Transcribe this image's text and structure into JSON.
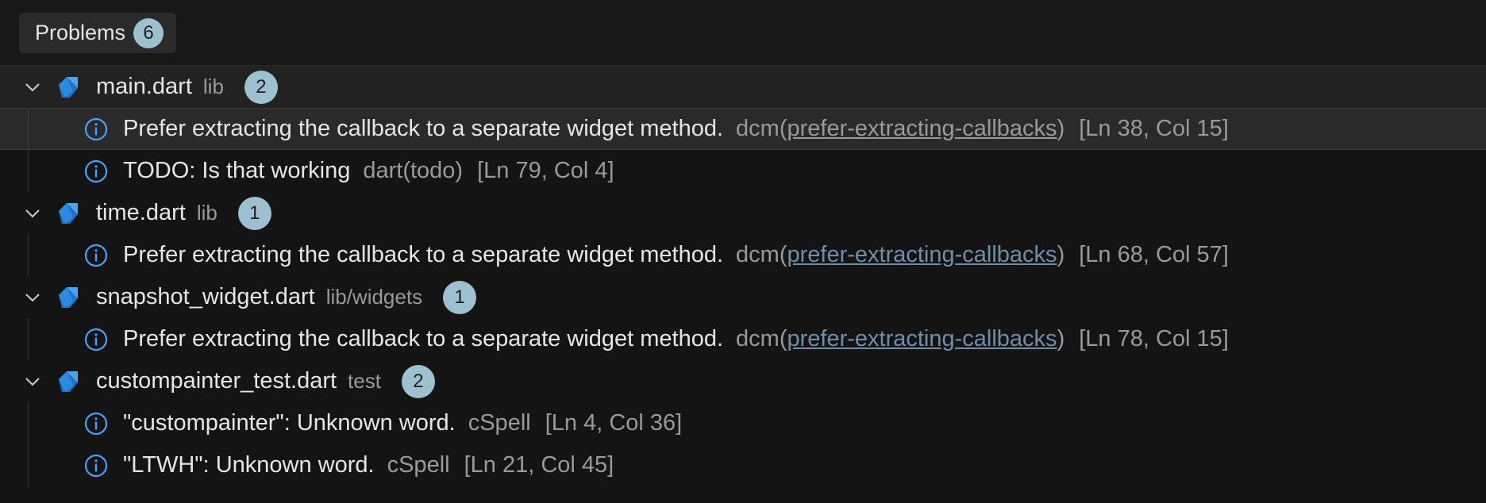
{
  "panel": {
    "tab_label": "Problems",
    "total_count": "6"
  },
  "files": [
    {
      "name": "main.dart",
      "dir": "lib",
      "count": "2",
      "problems": [
        {
          "message": "Prefer extracting the callback to a separate widget method.",
          "source": "dcm(",
          "code": "prefer-extracting-callbacks",
          "source_close": ")",
          "location": "[Ln 38, Col 15]"
        },
        {
          "message": "TODO: Is that working",
          "source": "dart(todo)",
          "code": "",
          "source_close": "",
          "location": "[Ln 79, Col 4]"
        }
      ]
    },
    {
      "name": "time.dart",
      "dir": "lib",
      "count": "1",
      "problems": [
        {
          "message": "Prefer extracting the callback to a separate widget method.",
          "source": "dcm(",
          "code": "prefer-extracting-callbacks",
          "source_close": ")",
          "location": "[Ln 68, Col 57]"
        }
      ]
    },
    {
      "name": "snapshot_widget.dart",
      "dir": "lib/widgets",
      "count": "1",
      "problems": [
        {
          "message": "Prefer extracting the callback to a separate widget method.",
          "source": "dcm(",
          "code": "prefer-extracting-callbacks",
          "source_close": ")",
          "location": "[Ln 78, Col 15]"
        }
      ]
    },
    {
      "name": "custompainter_test.dart",
      "dir": "test",
      "count": "2",
      "problems": [
        {
          "message": "\"custompainter\": Unknown word.",
          "source": "cSpell",
          "code": "",
          "source_close": "",
          "location": "[Ln 4, Col 36]"
        },
        {
          "message": "\"LTWH\": Unknown word.",
          "source": "cSpell",
          "code": "",
          "source_close": "",
          "location": "[Ln 21, Col 45]"
        }
      ]
    }
  ],
  "colors": {
    "background": "#141414",
    "badge": "#9ec1d2",
    "info": "#4a9eff",
    "link": "#6f8fa8"
  }
}
